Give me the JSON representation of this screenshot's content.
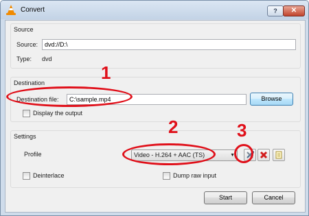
{
  "window": {
    "title": "Convert",
    "help_label": "?",
    "close_label": "✕"
  },
  "source": {
    "group_title": "Source",
    "source_label": "Source:",
    "source_value": "dvd://D:\\",
    "type_label": "Type:",
    "type_value": "dvd"
  },
  "destination": {
    "group_title": "Destination",
    "file_label": "Destination file:",
    "file_value": "C:\\sample.mp4",
    "browse_label": "Browse",
    "display_output_label": "Display the output",
    "display_output_checked": false
  },
  "settings": {
    "group_title": "Settings",
    "profile_label": "Profile",
    "profile_selected": "Video - H.264 + AAC (TS)",
    "deinterlace_label": "Deinterlace",
    "deinterlace_checked": false,
    "dump_raw_label": "Dump raw input",
    "dump_raw_checked": false,
    "icons": [
      "edit-profile-icon",
      "delete-profile-icon",
      "new-profile-icon"
    ]
  },
  "footer": {
    "start_label": "Start",
    "cancel_label": "Cancel"
  },
  "annotations": {
    "marker_1": "1",
    "marker_2": "2",
    "marker_3": "3",
    "color": "#e0101a"
  }
}
